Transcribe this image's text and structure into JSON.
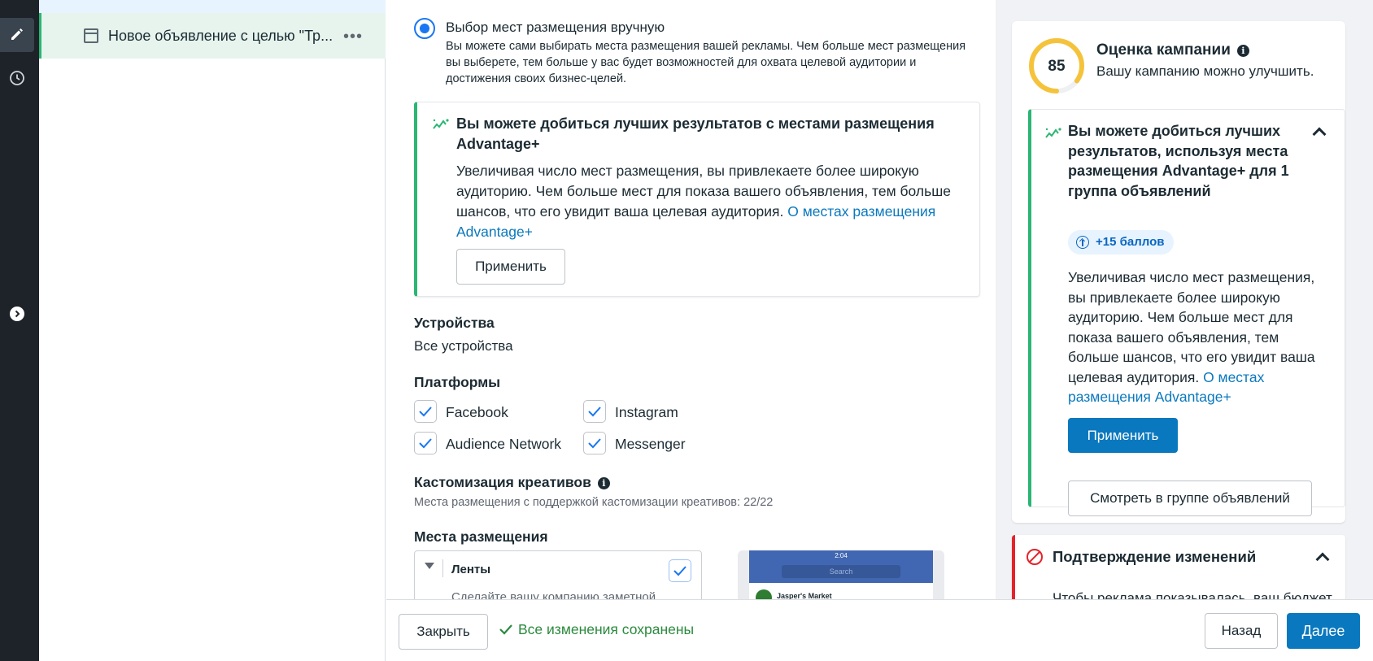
{
  "tree": {
    "item_label": "Новое объявление с целью \"Тр...",
    "more": "•••"
  },
  "placement": {
    "manual_label": "Выбор мест размещения вручную",
    "manual_desc": "Вы можете сами выбирать места размещения вашей рекламы. Чем больше мест размещения вы выберете, тем больше у вас будет возможностей для охвата целевой аудитории и достижения своих бизнес-целей."
  },
  "tip": {
    "title": "Вы можете добиться лучших результатов с местами размещения Advantage+",
    "body": "Увеличивая число мест размещения, вы привлекаете более широкую аудиторию. Чем больше мест для показа вашего объявления, тем больше шансов, что его увидит ваша целевая аудитория.",
    "link": "О местах размещения Advantage+",
    "apply": "Применить"
  },
  "devices": {
    "title": "Устройства",
    "value": "Все устройства"
  },
  "platforms": {
    "title": "Платформы",
    "items": [
      {
        "label": "Facebook",
        "checked": true
      },
      {
        "label": "Instagram",
        "checked": true
      },
      {
        "label": "Audience Network",
        "checked": true
      },
      {
        "label": "Messenger",
        "checked": true
      }
    ]
  },
  "customization": {
    "title": "Кастомизация креативов",
    "info": "i",
    "desc": "Места размещения с поддержкой кастомизации креативов: 22/22"
  },
  "placements_section": {
    "title": "Места размещения",
    "feeds_title": "Ленты",
    "feeds_desc": "Сделайте вашу компанию заметной",
    "preview_time": "2:04",
    "preview_search": "Search",
    "preview_page": "Jasper's Market"
  },
  "score": {
    "value": "85",
    "value_fraction": 0.85,
    "title": "Оценка кампании",
    "subtitle": "Вашу кампанию можно улучшить."
  },
  "recommendation": {
    "title": "Вы можете добиться лучших результатов, используя места размещения Advantage+ для 1 группа объявлений",
    "points": "+15 баллов",
    "body": "Увеличивая число мест размещения, вы привлекаете более широкую аудиторию. Чем больше мест для показа вашего объявления, тем больше шансов, что его увидит ваша целевая аудитория.",
    "link": "О местах размещения Advantage+",
    "apply": "Применить",
    "view": "Смотреть в группе объявлений"
  },
  "confirm": {
    "title": "Подтверждение изменений",
    "body": "Чтобы реклама показывалась, ваш бюджет"
  },
  "footer": {
    "close": "Закрыть",
    "saved": "Все изменения сохранены",
    "back": "Назад",
    "next": "Далее"
  },
  "colors": {
    "accent": "#0a78be",
    "radio": "#1877f2",
    "success": "#2bb673",
    "error": "#e4242b",
    "gauge": "#f5c33b"
  }
}
